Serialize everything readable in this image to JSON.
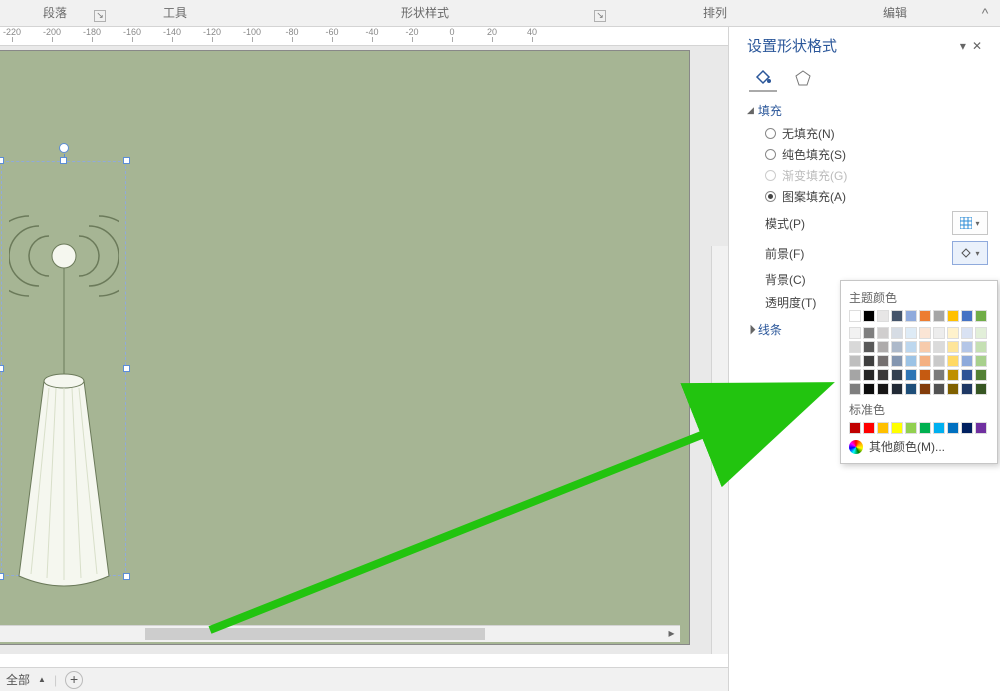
{
  "ribbon": {
    "groups": [
      "段落",
      "工具",
      "形状样式",
      "排列",
      "编辑"
    ],
    "collapse": "^"
  },
  "ruler": {
    "ticks": [
      -220,
      -200,
      -180,
      -160,
      -140,
      -120,
      -100,
      -80,
      -60,
      -40,
      -20,
      0,
      20,
      40
    ]
  },
  "pane": {
    "title": "设置形状格式",
    "section_fill": "填充",
    "fill_options": {
      "none": "无填充(N)",
      "solid": "纯色填充(S)",
      "gradient": "渐变填充(G)",
      "pattern": "图案填充(A)"
    },
    "props": {
      "pattern": "模式(P)",
      "foreground": "前景(F)",
      "background": "背景(C)",
      "transparency": "透明度(T)"
    },
    "section_line": "线条"
  },
  "popup": {
    "theme_label": "主题颜色",
    "standard_label": "标准色",
    "more_label": "其他颜色(M)...",
    "theme_row1": [
      "#ffffff",
      "#000000",
      "#e7e6e6",
      "#44546a",
      "#8faadc",
      "#ed7d31",
      "#a5a5a5",
      "#ffc000",
      "#4472c4",
      "#70ad47"
    ],
    "theme_shades": [
      [
        "#f2f2f2",
        "#7f7f7f",
        "#d0cece",
        "#d6dce4",
        "#deebf6",
        "#fbe5d5",
        "#ededed",
        "#fff2cc",
        "#d9e2f3",
        "#e2efd9"
      ],
      [
        "#d8d8d8",
        "#595959",
        "#aeabab",
        "#adb9ca",
        "#bdd7ee",
        "#f7cbac",
        "#dbdbdb",
        "#fee599",
        "#b4c6e7",
        "#c5e0b3"
      ],
      [
        "#bfbfbf",
        "#3f3f3f",
        "#757070",
        "#8496b0",
        "#9cc3e5",
        "#f4b183",
        "#c9c9c9",
        "#ffd965",
        "#8eaadb",
        "#a8d08d"
      ],
      [
        "#a5a5a5",
        "#262626",
        "#3a3838",
        "#323f4f",
        "#2e75b5",
        "#c55a11",
        "#7b7b7b",
        "#bf9000",
        "#2f5496",
        "#538135"
      ],
      [
        "#7f7f7f",
        "#0c0c0c",
        "#171616",
        "#222a35",
        "#1e4e79",
        "#833c0b",
        "#525252",
        "#7f6000",
        "#1f3864",
        "#375623"
      ]
    ],
    "standard": [
      "#c00000",
      "#ff0000",
      "#ffc000",
      "#ffff00",
      "#92d050",
      "#00b050",
      "#00b0f0",
      "#0070c0",
      "#002060",
      "#7030a0"
    ]
  },
  "pagesbar": {
    "all": "全部",
    "dd": "▲"
  }
}
